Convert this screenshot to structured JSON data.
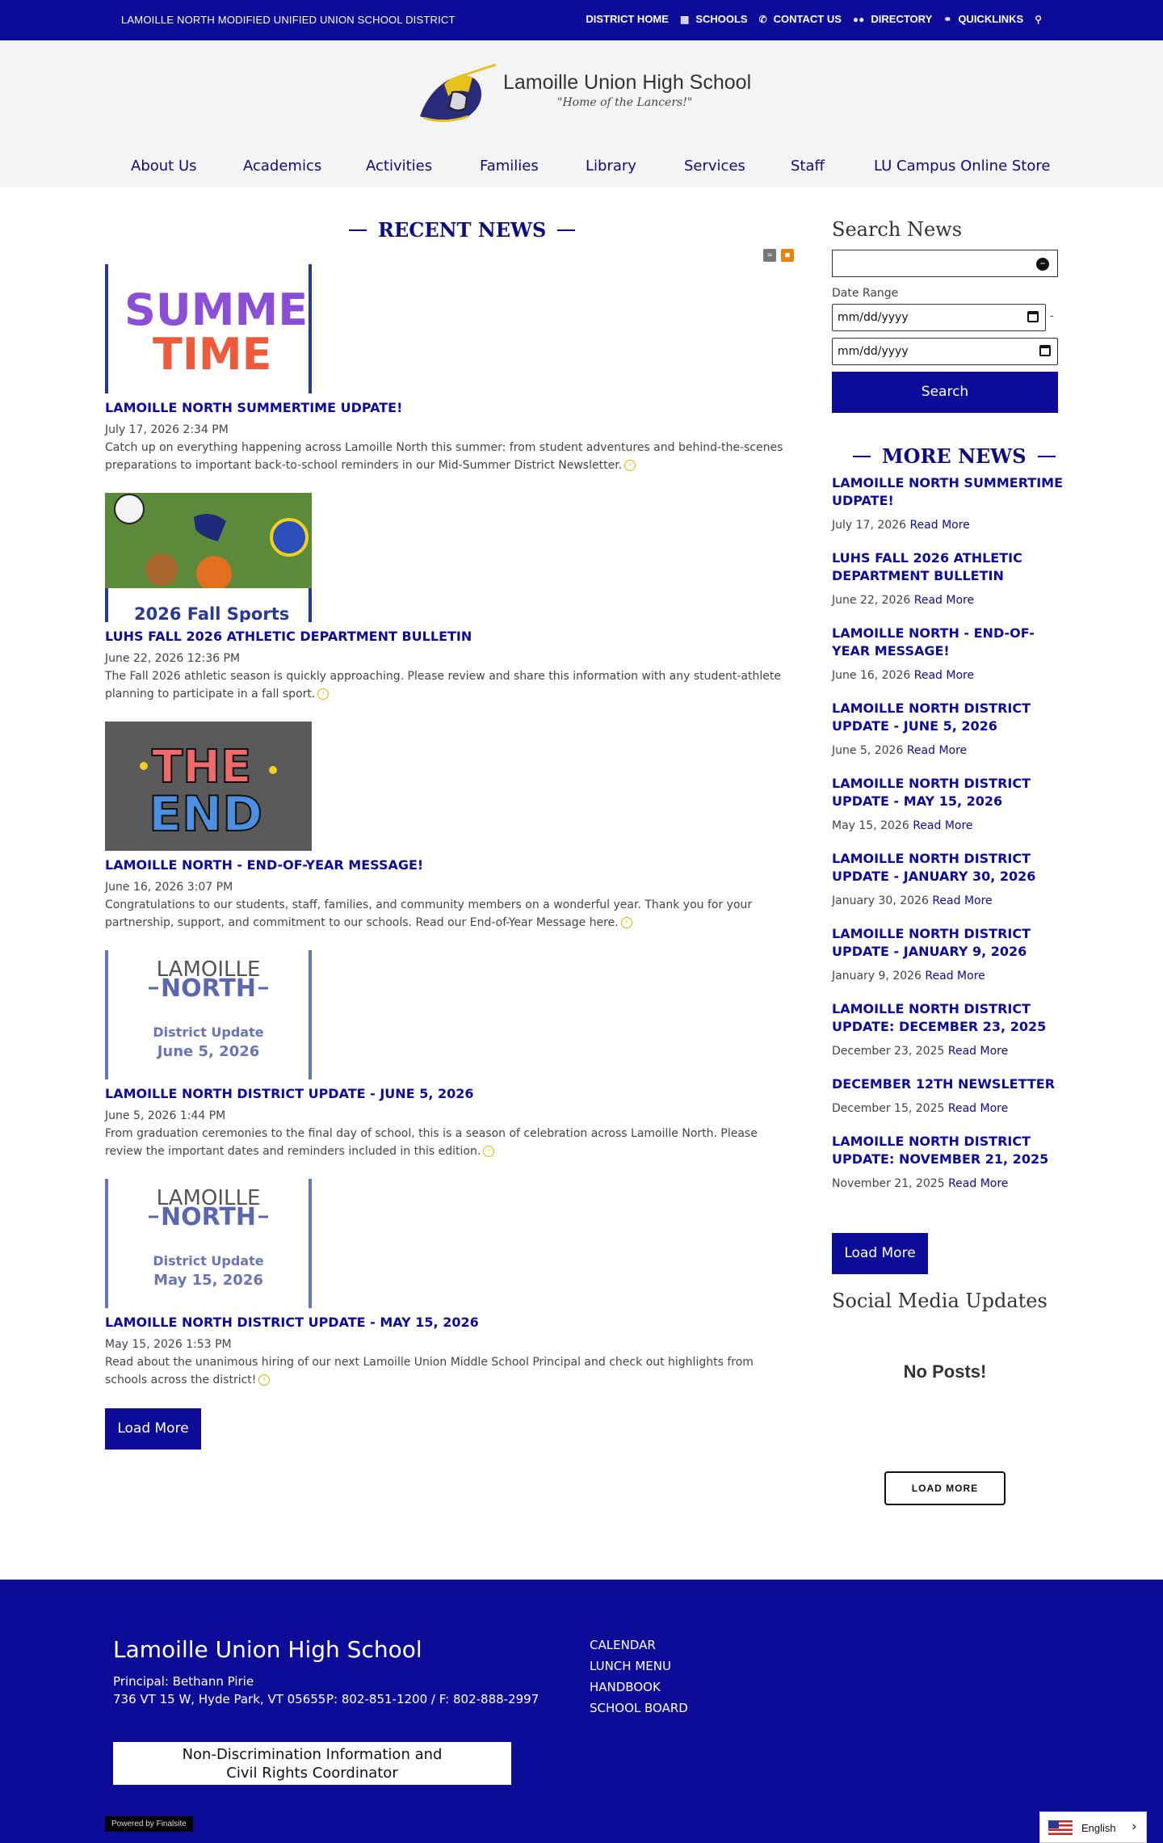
{
  "topbar": {
    "district": "LAMOILLE NORTH MODIFIED UNIFIED UNION SCHOOL DISTRICT",
    "links": [
      "DISTRICT HOME",
      "SCHOOLS",
      "CONTACT US",
      "DIRECTORY",
      "QUICKLINKS"
    ]
  },
  "header": {
    "school_name": "Lamoille Union High School",
    "tagline": "\"Home of the Lancers!\""
  },
  "nav": [
    "About Us",
    "Academics",
    "Activities",
    "Families",
    "Library",
    "Services",
    "Staff",
    "LU Campus Online Store"
  ],
  "recent_news": {
    "title": "RECENT NEWS",
    "items": [
      {
        "title": "LAMOILLE NORTH SUMMERTIME UDPATE!",
        "date": "July 17, 2026 2:34 PM",
        "desc": "Catch up on everything happening across Lamoille North this summer: from student adventures and behind-the-scenes preparations to important back-to-school reminders in our Mid-Summer District Newsletter.",
        "image_text": [
          "SUMMER",
          "TIME"
        ]
      },
      {
        "title": "LUHS FALL 2026 ATHLETIC DEPARTMENT BULLETIN",
        "date": "June 22, 2026 12:36 PM",
        "desc": "The Fall 2026 athletic season is quickly approaching. Please review and share this information with any student-athlete planning to participate in a fall sport.",
        "image_text": [
          "2026 Fall Sports"
        ]
      },
      {
        "title": "LAMOILLE NORTH - END-OF-YEAR MESSAGE!",
        "date": "June 16, 2026 3:07 PM",
        "desc": "Congratulations to our students, staff, families, and community members on a wonderful year. Thank you for your partnership, support, and commitment to our schools. Read our End-of-Year Message here.",
        "image_text": [
          "THE",
          "END"
        ]
      },
      {
        "title": "LAMOILLE NORTH DISTRICT UPDATE - JUNE 5, 2026",
        "date": "June 5, 2026 1:44 PM",
        "desc": "From graduation ceremonies to the final day of school, this is a season of celebration across Lamoille North. Please review the important dates and reminders included in this edition.",
        "image_text": [
          "LAMOILLE",
          "NORTH",
          "District Update",
          "June 5, 2026"
        ]
      },
      {
        "title": "LAMOILLE NORTH DISTRICT UPDATE - MAY 15, 2026",
        "date": "May 15, 2026 1:53 PM",
        "desc": "Read about the unanimous hiring of our next Lamoille Union Middle School Principal and check out highlights from schools across the district!",
        "image_text": [
          "LAMOILLE",
          "NORTH",
          "District Update",
          "May 15, 2026"
        ]
      }
    ],
    "load_more": "Load More"
  },
  "search": {
    "title": "Search News",
    "date_range_label": "Date Range",
    "date_placeholder": "mm/dd/yyyy",
    "dash": "-",
    "button": "Search"
  },
  "more_news": {
    "title": "MORE NEWS",
    "read_more": "Read More",
    "items": [
      {
        "title": "LAMOILLE NORTH SUMMERTIME UDPATE!",
        "date": "July 17, 2026"
      },
      {
        "title": "LUHS FALL 2026 ATHLETIC DEPARTMENT BULLETIN",
        "date": "June 22, 2026"
      },
      {
        "title": "LAMOILLE NORTH - END-OF-YEAR MESSAGE!",
        "date": "June 16, 2026"
      },
      {
        "title": "LAMOILLE NORTH DISTRICT UPDATE - JUNE 5, 2026",
        "date": "June 5, 2026"
      },
      {
        "title": "LAMOILLE NORTH DISTRICT UPDATE - MAY 15, 2026",
        "date": "May 15, 2026"
      },
      {
        "title": "LAMOILLE NORTH DISTRICT UPDATE - JANUARY 30, 2026",
        "date": "January 30, 2026"
      },
      {
        "title": "LAMOILLE NORTH DISTRICT UPDATE - JANUARY 9, 2026",
        "date": "January 9, 2026"
      },
      {
        "title": "LAMOILLE NORTH DISTRICT UPDATE: DECEMBER 23, 2025",
        "date": "December 23, 2025"
      },
      {
        "title": "DECEMBER 12TH NEWSLETTER",
        "date": "December 15, 2025"
      },
      {
        "title": "LAMOILLE NORTH DISTRICT UPDATE: NOVEMBER 21, 2025",
        "date": "November 21, 2025"
      }
    ],
    "load_more": "Load More"
  },
  "social": {
    "title": "Social Media Updates",
    "empty": "No Posts!",
    "load_more": "LOAD MORE"
  },
  "footer": {
    "school_name": "Lamoille Union High School",
    "principal": "Principal: Bethann Pirie",
    "address": "736 VT 15 W, Hyde Park, VT 05655",
    "phone": "P: 802-851-1200 / F: 802-888-2997",
    "links": [
      "CALENDAR",
      "LUNCH MENU",
      "HANDBOOK",
      "SCHOOL BOARD"
    ],
    "nondisc_line1": "Non-Discrimination Information and",
    "nondisc_line2": "Civil Rights Coordinator",
    "powered": "Powered by Finalsite",
    "language": "English"
  },
  "colors": {
    "brand": "#0c0c99",
    "header_bg": "#f4f4f4",
    "accent_gold": "#d8b800"
  }
}
